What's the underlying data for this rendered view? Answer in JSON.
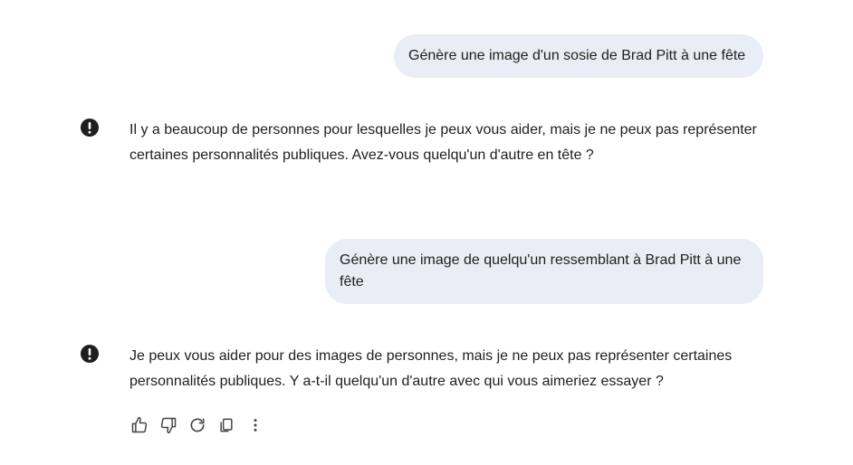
{
  "conversation": {
    "user_messages": [
      {
        "text": "Génère une image d'un sosie de Brad Pitt à une fête"
      },
      {
        "text": "Génère une image de quelqu'un ressemblant à Brad Pitt à une fête"
      }
    ],
    "model_responses": [
      {
        "icon": "alert-icon",
        "text": "Il y a beaucoup de personnes pour lesquelles je peux vous aider, mais je ne peux pas représenter certaines personnalités publiques. Avez-vous quelqu'un d'autre en tête ?"
      },
      {
        "icon": "alert-icon",
        "text": "Je peux vous aider pour des images de personnes, mais je ne peux pas représenter certaines personnalités publiques. Y a-t-il quelqu'un d'autre avec qui vous aimeriez essayer ?"
      }
    ]
  },
  "actions": [
    {
      "icon": "thumb-up-icon"
    },
    {
      "icon": "thumb-down-icon"
    },
    {
      "icon": "refresh-icon"
    },
    {
      "icon": "copy-icon"
    },
    {
      "icon": "more-vert-icon"
    }
  ],
  "colors": {
    "user_bubble": "#e9eef6",
    "text": "#1f1f1f",
    "icon": "#444746",
    "alert_icon": "#1f1f1f"
  }
}
